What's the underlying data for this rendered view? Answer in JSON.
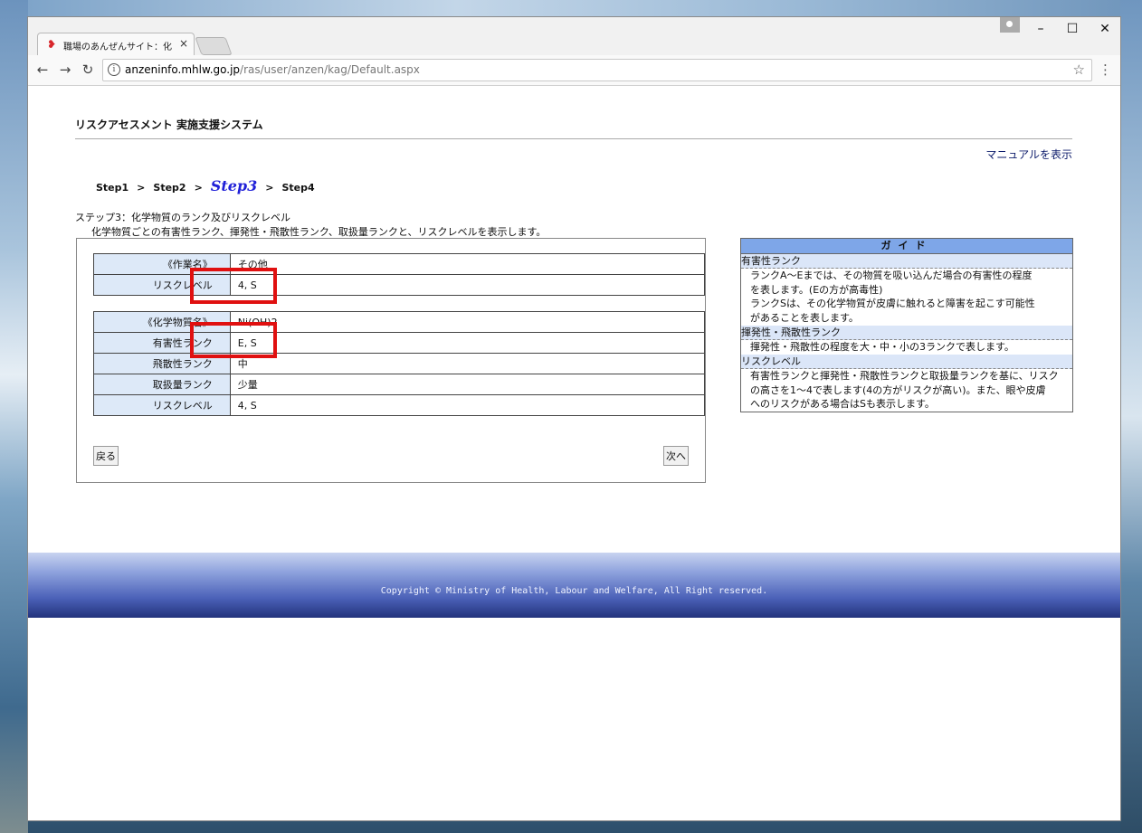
{
  "browser": {
    "tab_title": "職場のあんぜんサイト：化学",
    "tab_close": "×",
    "url_domain": "anzeninfo.mhlw.go.jp",
    "url_path": "/ras/user/anzen/kag/Default.aspx",
    "minimize": "–",
    "maximize": "☐",
    "close": "✕"
  },
  "page": {
    "system_title": "リスクアセスメント 実施支援システム",
    "manual_link": "マニュアルを表示",
    "steps": [
      "Step1",
      "Step2",
      "Step3",
      "Step4"
    ],
    "step_separator": ">",
    "current_step": "Step3",
    "step_heading": "ステップ3：化学物質のランク及びリスクレベル",
    "step_description": "化学物質ごとの有害性ランク、揮発性・飛散性ランク、取扱量ランクと、リスクレベルを表示します。",
    "work_table": [
      {
        "label": "《作業名》",
        "value": "その他"
      },
      {
        "label": "リスクレベル",
        "value": "4, S"
      }
    ],
    "chemical_table": [
      {
        "label": "《化学物質名》",
        "value": "Ni(OH)2"
      },
      {
        "label": "有害性ランク",
        "value": "E, S"
      },
      {
        "label": "飛散性ランク",
        "value": "中"
      },
      {
        "label": "取扱量ランク",
        "value": "少量"
      },
      {
        "label": "リスクレベル",
        "value": "4, S"
      }
    ],
    "back_button": "戻る",
    "next_button": "次へ"
  },
  "guide": {
    "title": "ガイド",
    "sections": [
      {
        "heading": "有害性ランク",
        "lines": [
          "ランクA〜Eまでは、その物質を吸い込んだ場合の有害性の程度",
          "を表します。(Eの方が高毒性)",
          "ランクSは、その化学物質が皮膚に触れると障害を起こす可能性",
          "があることを表します。"
        ]
      },
      {
        "heading": "揮発性・飛散性ランク",
        "lines": [
          "揮発性・飛散性の程度を大・中・小の3ランクで表します。"
        ]
      },
      {
        "heading": "リスクレベル",
        "lines": [
          "有害性ランクと揮発性・飛散性ランクと取扱量ランクを基に、リスク",
          "の高さを1〜4で表します(4の方がリスクが高い)。また、眼や皮膚",
          "へのリスクがある場合はSも表示します。"
        ]
      }
    ]
  },
  "footer": {
    "copyright": "Copyright © Ministry of Health, Labour and Welfare, All Right reserved."
  },
  "colors": {
    "label_cell_bg": "#dde9f8",
    "highlight_border": "#e01010",
    "guide_header_bg": "#7ea6e8",
    "current_step": "#2020d8"
  }
}
